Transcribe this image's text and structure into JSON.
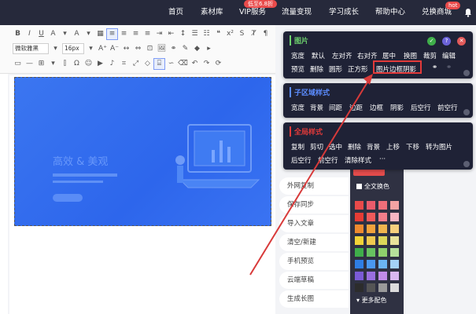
{
  "nav": {
    "items": [
      "首页",
      "素材库",
      "VIP服务",
      "流量变现",
      "学习成长",
      "帮助中心",
      "兑换商城"
    ],
    "vip_badge": "低至6.8折",
    "hot_badge": "hot"
  },
  "toolbar": {
    "font_family": "微软雅黑",
    "font_size": "16px"
  },
  "image_panel": {
    "title": "图片",
    "row1": [
      "宽度",
      "默认",
      "左对齐",
      "右对齐",
      "居中",
      "换图",
      "裁剪",
      "编辑"
    ],
    "row2": [
      "预览",
      "删除",
      "圆形",
      "正方形",
      "图片边框阴影"
    ],
    "accent": "#6ed36e"
  },
  "child_panel": {
    "title": "子区域样式",
    "row1": [
      "宽度",
      "背景",
      "间距",
      "边距",
      "边框",
      "阴影",
      "后空行",
      "前空行"
    ],
    "accent": "#5b8cff"
  },
  "block_panel": {
    "title": "全局样式",
    "row1": [
      "复制",
      "剪切",
      "选中",
      "删除",
      "背景",
      "上移",
      "下移",
      "转为图片"
    ],
    "row2": [
      "后空行",
      "前空行",
      "清除样式",
      "···"
    ],
    "accent": "#e23a3a"
  },
  "side_actions": [
    "外网复制",
    "保存同步",
    "导入文章",
    "清空/新建",
    "手机预览",
    "云端草稿",
    "生成长图"
  ],
  "palette": {
    "full_select": "全文换色",
    "more_colors": "更多配色",
    "colors": [
      "#e94a4a",
      "#ea5b6b",
      "#ef6e79",
      "#f4a3a3",
      "#e63c35",
      "#f05a5a",
      "#f27e8a",
      "#f7b5c2",
      "#ee8a2f",
      "#f2a33c",
      "#f0b54e",
      "#f6cf7d",
      "#f2d338",
      "#f0c94f",
      "#dcd659",
      "#e8e39a",
      "#3fae4a",
      "#67c160",
      "#8fcf6c",
      "#b6e09a",
      "#2f7ee4",
      "#4a98f0",
      "#6cb4f2",
      "#a4d2f8",
      "#7b5bd6",
      "#9a6fe0",
      "#c08ce8",
      "#d9b8f2",
      "#2c2c2c",
      "#555555",
      "#9a9a9a",
      "#dcdcdc"
    ]
  },
  "image_content": {
    "headline": "高效 & 美观"
  },
  "colors": {
    "topbar": "#26293b",
    "panel": "#1f2236",
    "image_blue": "#2d66ec",
    "highlight": "#e23a3a"
  }
}
